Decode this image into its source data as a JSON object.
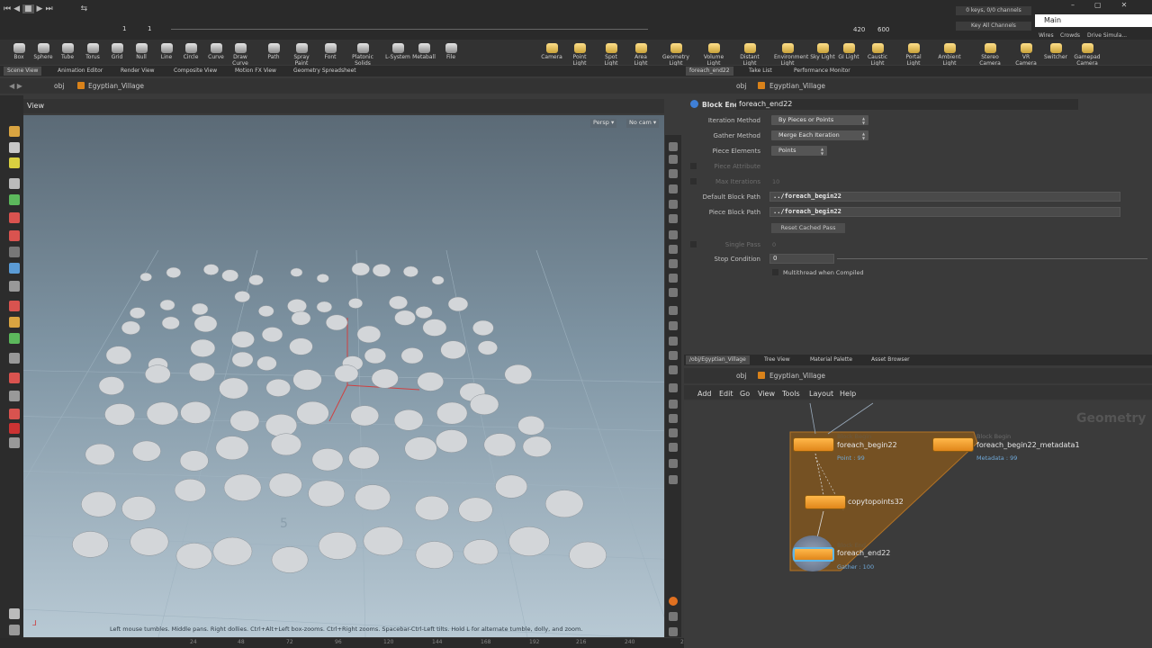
{
  "playbar": {
    "frame_start": "1",
    "frame_current": "1",
    "frame_end_a": "420",
    "frame_end_b": "600",
    "keys_text": "0 keys, 0/0 channels",
    "key_all_label": "Key All Channels"
  },
  "desktop": {
    "label": "Main",
    "tabs": [
      "Wires",
      "Crowds",
      "Drive Simula..."
    ]
  },
  "shelf_left": [
    "Box",
    "Sphere",
    "Tube",
    "Torus",
    "Grid",
    "Null",
    "Line",
    "Circle",
    "Curve",
    "Draw Curve",
    "Path",
    "Spray Paint",
    "Font",
    "Platonic Solids",
    "L-System",
    "Metaball",
    "File"
  ],
  "shelf_right": [
    "Camera",
    "Point Light",
    "Spot Light",
    "Area Light",
    "Geometry Light",
    "Volume Light",
    "Distant Light",
    "Environment Light",
    "Sky Light",
    "GI Light",
    "Caustic Light",
    "Portal Light",
    "Ambient Light",
    "Stereo Camera",
    "VR Camera",
    "Switcher",
    "Gamepad Camera"
  ],
  "left_tabs": [
    "Scene View",
    "Animation Editor",
    "Render View",
    "Composite View",
    "Motion FX View",
    "Geometry Spreadsheet"
  ],
  "right_tabs": [
    "foreach_end22",
    "Take List",
    "Performance Monitor"
  ],
  "path_left": {
    "obj": "obj",
    "node": "Egyptian_Village"
  },
  "path_right": {
    "obj": "obj",
    "node": "Egyptian_Village"
  },
  "viewport": {
    "title": "View",
    "persp": "Persp ▾",
    "cam": "No cam ▾",
    "hint": "Left mouse tumbles. Middle pans. Right dollies. Ctrl+Alt+Left box-zooms. Ctrl+Right zooms. Spacebar-Ctrl-Left tilts. Hold L for alternate tumble, dolly, and zoom.",
    "grid_label": "5"
  },
  "params": {
    "type_label": "Block End",
    "node_name": "foreach_end22",
    "rows": [
      {
        "label": "Iteration Method",
        "value": "By Pieces or Points",
        "kind": "dd"
      },
      {
        "label": "Gather Method",
        "value": "Merge Each Iteration",
        "kind": "dd"
      },
      {
        "label": "Piece Elements",
        "value": "Points",
        "kind": "dd"
      },
      {
        "label": "Piece Attribute",
        "value": "",
        "kind": "dim"
      },
      {
        "label": "Max Iterations",
        "value": "10",
        "kind": "dim"
      },
      {
        "label": "Default Block Path",
        "value": "../foreach_begin22",
        "kind": "fld"
      },
      {
        "label": "Piece Block Path",
        "value": "../foreach_begin22",
        "kind": "fld"
      }
    ],
    "reset_button": "Reset Cached Pass",
    "single_pass_label": "Single Pass",
    "single_pass_value": "0",
    "stop_label": "Stop Condition",
    "stop_value": "0",
    "multithread_label": "Multithread when Compiled"
  },
  "network": {
    "tabs": [
      "/obj/Egyptian_Village",
      "Tree View",
      "Material Palette",
      "Asset Browser"
    ],
    "menu": [
      "Add",
      "Edit",
      "Go",
      "View",
      "Tools",
      "Layout",
      "Help"
    ],
    "context": "Geometry",
    "nodes": [
      {
        "type": "Block Begin",
        "name": "foreach_begin22",
        "sub": "Point : 99"
      },
      {
        "type": "Block Begin",
        "name": "foreach_begin22_metadata1",
        "sub": "Metadata : 99"
      },
      {
        "type": "",
        "name": "copytopoints32",
        "sub": ""
      },
      {
        "type": "Block End",
        "name": "foreach_end22",
        "sub": "Gather : 100"
      }
    ]
  },
  "timeline_ticks": [
    "24",
    "48",
    "72",
    "96",
    "120",
    "144",
    "168",
    "192",
    "216",
    "240",
    "264",
    "288",
    "312",
    "336",
    "360",
    "384",
    "408"
  ]
}
